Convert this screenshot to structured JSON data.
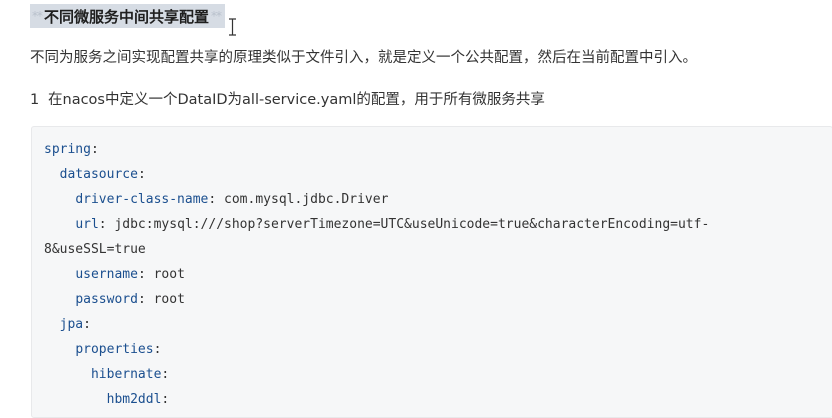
{
  "heading": {
    "text": "不同微服务中间共享配置",
    "md_prefix": "**",
    "md_suffix": "**"
  },
  "paragraph": "不同为服务之间实现配置共享的原理类似于文件引入，就是定义一个公共配置，然后在当前配置中引入。",
  "list_item": {
    "number": "1",
    "text": "在nacos中定义一个DataID为all-service.yaml的配置，用于所有微服务共享"
  },
  "code_lines": [
    {
      "indent": "",
      "key": "spring",
      "sep": ":",
      "value": ""
    },
    {
      "indent": "  ",
      "key": "datasource",
      "sep": ":",
      "value": ""
    },
    {
      "indent": "    ",
      "key": "driver-class-name",
      "sep": ":",
      "value": " com.mysql.jdbc.Driver"
    },
    {
      "indent": "    ",
      "key": "url",
      "sep": ":",
      "value": " jdbc:mysql:///shop?serverTimezone=UTC&useUnicode=true&characterEncoding=utf-"
    },
    {
      "indent": "",
      "key": "",
      "sep": "",
      "value": "8&useSSL=true"
    },
    {
      "indent": "    ",
      "key": "username",
      "sep": ":",
      "value": " root"
    },
    {
      "indent": "    ",
      "key": "password",
      "sep": ":",
      "value": " root"
    },
    {
      "indent": "  ",
      "key": "jpa",
      "sep": ":",
      "value": ""
    },
    {
      "indent": "    ",
      "key": "properties",
      "sep": ":",
      "value": ""
    },
    {
      "indent": "      ",
      "key": "hibernate",
      "sep": ":",
      "value": ""
    },
    {
      "indent": "        ",
      "key": "hbm2ddl",
      "sep": ":",
      "value": ""
    }
  ],
  "colors": {
    "heading_highlight": "#d6dce4",
    "code_background": "#f6f7f8",
    "yaml_key": "#1b4f8f",
    "text": "#333333"
  }
}
